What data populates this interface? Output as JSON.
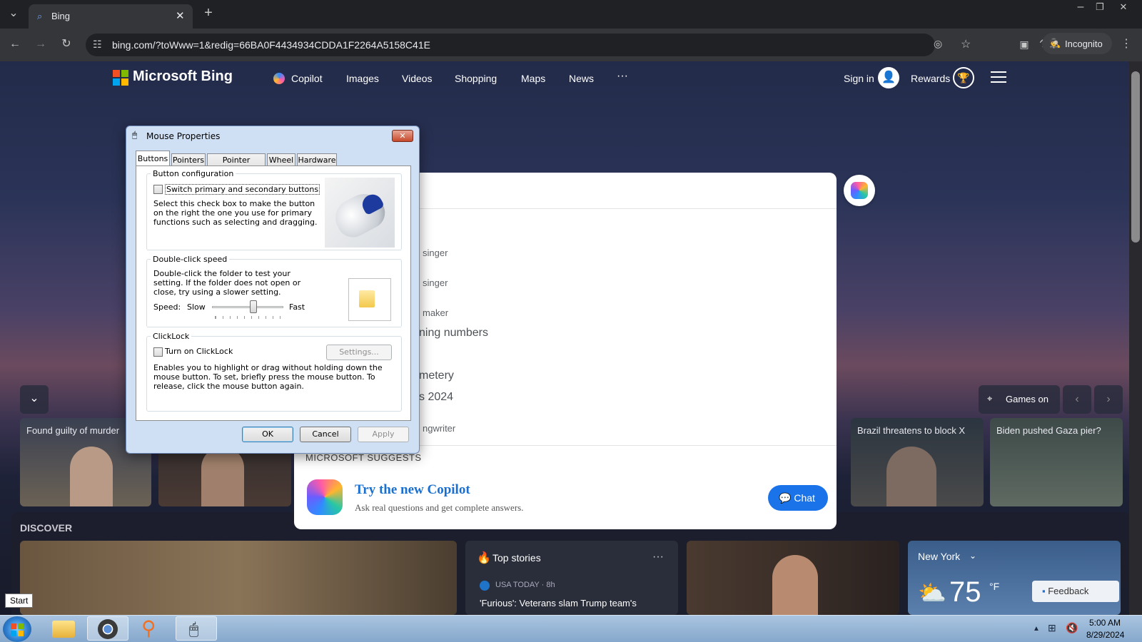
{
  "browser": {
    "tab_title": "Bing",
    "url": "bing.com/?toWww=1&redig=66BA0F4434934CDDA1F2264A5158C41E",
    "profile_label": "Incognito"
  },
  "bing": {
    "logo": "Microsoft Bing",
    "nav": [
      "Copilot",
      "Images",
      "Videos",
      "Shopping",
      "Maps",
      "News",
      "···"
    ],
    "sign_in": "Sign in",
    "rewards": "Rewards",
    "suggestions": [
      "singer",
      "singer",
      "maker",
      "ning numbers",
      "metery",
      "s 2024",
      "ngwriter"
    ],
    "ms_suggests": "MICROSOFT SUGGESTS",
    "copilot_title": "Try the new Copilot",
    "copilot_desc": "Ask real questions and get complete answers.",
    "chat_label": "Chat",
    "games_label": "Games on",
    "news": [
      "Found guilty of murder",
      "Brazil threatens to block X",
      "Biden pushed Gaza pier?"
    ],
    "discover": "DISCOVER",
    "top_stories": "Top stories",
    "source": "USA TODAY · 8h",
    "headline": "'Furious': Veterans slam Trump team's",
    "weather_city": "New York",
    "weather_temp": "75",
    "weather_unit": "°F",
    "feedback": "Feedback"
  },
  "dialog": {
    "title": "Mouse Properties",
    "tabs": [
      "Buttons",
      "Pointers",
      "Pointer Options",
      "Wheel",
      "Hardware"
    ],
    "button_config": {
      "label": "Button configuration",
      "checkbox": "Switch primary and secondary buttons",
      "desc": "Select this check box to make the button on the right the one you use for primary functions such as selecting and dragging."
    },
    "dblclick": {
      "label": "Double-click speed",
      "desc": "Double-click the folder to test your setting. If the folder does not open or close, try using a slower setting.",
      "speed": "Speed:",
      "slow": "Slow",
      "fast": "Fast",
      "value": 0.58
    },
    "clicklock": {
      "label": "ClickLock",
      "checkbox": "Turn on ClickLock",
      "settings": "Settings...",
      "desc": "Enables you to highlight or drag without holding down the mouse button. To set, briefly press the mouse button. To release, click the mouse button again."
    },
    "ok": "OK",
    "cancel": "Cancel",
    "apply": "Apply"
  },
  "taskbar": {
    "start_tooltip": "Start",
    "time": "5:00 AM",
    "date": "8/29/2024"
  }
}
